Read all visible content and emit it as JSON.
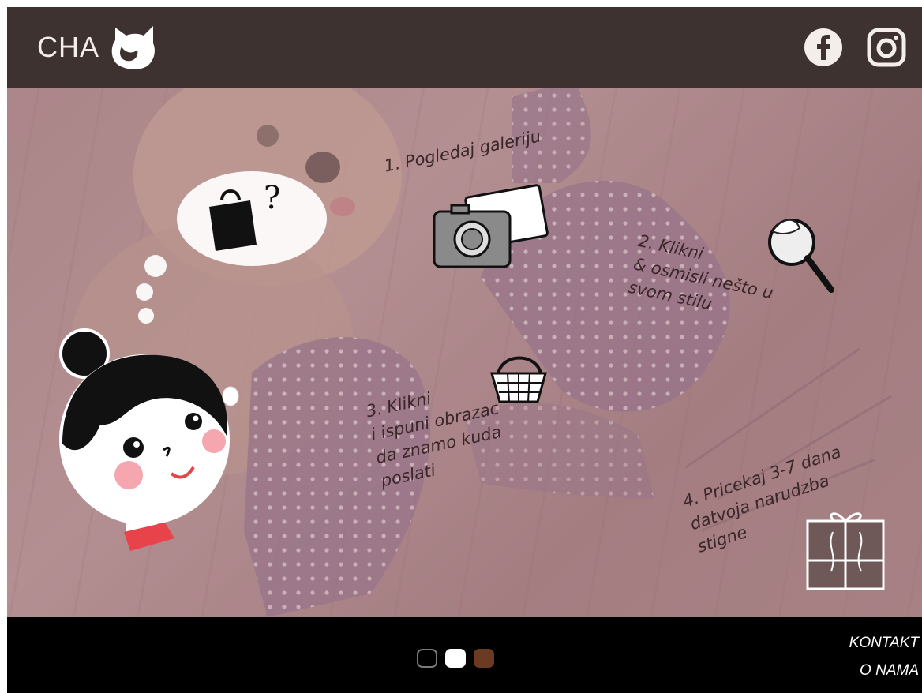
{
  "header": {
    "logo_text": "CHA",
    "social": [
      {
        "name": "facebook",
        "icon": "facebook-icon"
      },
      {
        "name": "instagram",
        "icon": "instagram-icon"
      }
    ]
  },
  "steps": {
    "step1": "1. Pogledaj galeriju",
    "step2": "2. Klikni\n& osmisli nešto u\nsvom stilu",
    "step3": "3. Klikni\ni ispuni obrazac\nda znamo kuda\nposlati",
    "step4": "4. Pricekaj 3-7 dana\ndatvoja narudzba\nstigne"
  },
  "thought": {
    "text": "?"
  },
  "footer": {
    "links": [
      "KONTAKT",
      "O NAMA"
    ],
    "dots": [
      "black",
      "white",
      "brown"
    ]
  },
  "colors": {
    "header_bg": "#3d3230",
    "footer_bg": "#000000",
    "hero_tint": "#b49194",
    "accent_red": "#e8424a",
    "dot_brown": "#6b3a22"
  },
  "icons": {
    "brand": "cat-head-icon",
    "step1": "photos-icon",
    "step2": "magnifier-brush-icon",
    "step3": "shopping-basket-icon",
    "step4": "gift-box-icon",
    "thought": "shopping-bag-icon"
  }
}
